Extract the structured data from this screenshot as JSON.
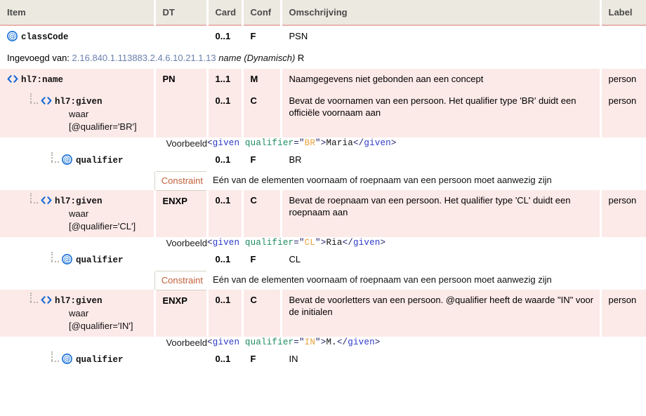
{
  "table": {
    "headers": [
      "Item",
      "DT",
      "Card",
      "Conf",
      "Omschrijving",
      "Label"
    ],
    "rows": [
      {
        "kind": "element",
        "style": "plain",
        "level": 0,
        "guide": false,
        "icon": "attribute-at-icon",
        "item": "classCode",
        "condition": "",
        "dt": "",
        "card": "0..1",
        "conf": "F",
        "omschrijving": "PSN",
        "label": ""
      },
      {
        "kind": "inserted",
        "prefix": "Ingevoegd van:",
        "oid": "2.16.840.1.113883.2.4.6.10.21.1.13",
        "name": "name (Dynamisch)",
        "suffix": "R"
      },
      {
        "kind": "element",
        "style": "pink",
        "level": 0,
        "guide": false,
        "icon": "element-angle-icon",
        "item": "hl7:name",
        "condition": "",
        "dt": "PN",
        "card": "1..1",
        "conf": "M",
        "omschrijving": "Naamgegevens niet gebonden aan een concept",
        "label": "person"
      },
      {
        "kind": "element",
        "style": "pink",
        "level": 1,
        "guide": true,
        "icon": "element-angle-icon",
        "item": "hl7:given",
        "condition": "waar\n[@qualifier='BR']",
        "dt": "",
        "card": "0..1",
        "conf": "C",
        "omschrijving": "Bevat de voornamen van een persoon. Het qualifier type 'BR' duidt een officiële voornaam aan",
        "label": "person"
      },
      {
        "kind": "example",
        "label_text": "Voorbeeld",
        "code": [
          {
            "t": "<",
            "c": "br"
          },
          {
            "t": "given",
            "c": "tag"
          },
          {
            "t": " ",
            "c": "txt"
          },
          {
            "t": "qualifier",
            "c": "attr"
          },
          {
            "t": "=",
            "c": "eq"
          },
          {
            "t": "\"",
            "c": "q"
          },
          {
            "t": "BR",
            "c": "val"
          },
          {
            "t": "\"",
            "c": "q"
          },
          {
            "t": ">",
            "c": "br"
          },
          {
            "t": "Maria",
            "c": "txt"
          },
          {
            "t": "</",
            "c": "br"
          },
          {
            "t": "given",
            "c": "tag"
          },
          {
            "t": ">",
            "c": "br"
          }
        ]
      },
      {
        "kind": "element",
        "style": "plain",
        "level": 2,
        "guide": true,
        "icon": "attribute-at-icon",
        "item": "qualifier",
        "condition": "",
        "dt": "",
        "card": "0..1",
        "conf": "F",
        "omschrijving": "BR",
        "label": ""
      },
      {
        "kind": "constraint",
        "label_text": "Constraint",
        "text": "Eén van de elementen voornaam of roepnaam van een persoon moet aanwezig zijn"
      },
      {
        "kind": "element",
        "style": "pink",
        "level": 1,
        "guide": true,
        "icon": "element-angle-icon",
        "item": "hl7:given",
        "condition": "waar\n[@qualifier='CL']",
        "dt": "ENXP",
        "card": "0..1",
        "conf": "C",
        "omschrijving": "Bevat de roepnaam van een persoon. Het qualifier type 'CL' duidt een roepnaam aan",
        "label": "person"
      },
      {
        "kind": "example",
        "label_text": "Voorbeeld",
        "code": [
          {
            "t": "<",
            "c": "br"
          },
          {
            "t": "given",
            "c": "tag"
          },
          {
            "t": " ",
            "c": "txt"
          },
          {
            "t": "qualifier",
            "c": "attr"
          },
          {
            "t": "=",
            "c": "eq"
          },
          {
            "t": "\"",
            "c": "q"
          },
          {
            "t": "CL",
            "c": "val"
          },
          {
            "t": "\"",
            "c": "q"
          },
          {
            "t": ">",
            "c": "br"
          },
          {
            "t": "Ria",
            "c": "txt"
          },
          {
            "t": "</",
            "c": "br"
          },
          {
            "t": "given",
            "c": "tag"
          },
          {
            "t": ">",
            "c": "br"
          }
        ]
      },
      {
        "kind": "element",
        "style": "plain",
        "level": 2,
        "guide": true,
        "icon": "attribute-at-icon",
        "item": "qualifier",
        "condition": "",
        "dt": "",
        "card": "0..1",
        "conf": "F",
        "omschrijving": "CL",
        "label": ""
      },
      {
        "kind": "constraint",
        "label_text": "Constraint",
        "text": "Eén van de elementen voornaam of roepnaam van een persoon moet aanwezig zijn"
      },
      {
        "kind": "element",
        "style": "pink",
        "level": 1,
        "guide": true,
        "icon": "element-angle-icon",
        "item": "hl7:given",
        "condition": "waar\n[@qualifier='IN']",
        "dt": "ENXP",
        "card": "0..1",
        "conf": "C",
        "omschrijving": "Bevat de voorletters van een persoon. @qualifier heeft de waarde \"IN\" voor de initialen",
        "label": "person"
      },
      {
        "kind": "example",
        "label_text": "Voorbeeld",
        "code": [
          {
            "t": "<",
            "c": "br"
          },
          {
            "t": "given",
            "c": "tag"
          },
          {
            "t": " ",
            "c": "txt"
          },
          {
            "t": "qualifier",
            "c": "attr"
          },
          {
            "t": "=",
            "c": "eq"
          },
          {
            "t": "\"",
            "c": "q"
          },
          {
            "t": "IN",
            "c": "val"
          },
          {
            "t": "\"",
            "c": "q"
          },
          {
            "t": ">",
            "c": "br"
          },
          {
            "t": "M.",
            "c": "txt"
          },
          {
            "t": "</",
            "c": "br"
          },
          {
            "t": "given",
            "c": "tag"
          },
          {
            "t": ">",
            "c": "br"
          }
        ]
      },
      {
        "kind": "element",
        "style": "plain",
        "level": 2,
        "guide": true,
        "icon": "attribute-at-icon",
        "item": "qualifier",
        "condition": "",
        "dt": "",
        "card": "0..1",
        "conf": "F",
        "omschrijving": "IN",
        "label": ""
      }
    ]
  },
  "colors": {
    "header_bg": "#ece9e0",
    "header_border": "#eab3ae",
    "row_pink": "#fceae8",
    "example_bg": "#e6e8f5",
    "example_label_bg": "#e2e4f2",
    "constraint_text": "#c1603a",
    "oid_link": "#6b7fae",
    "icon_blue": "#1e73d8"
  }
}
